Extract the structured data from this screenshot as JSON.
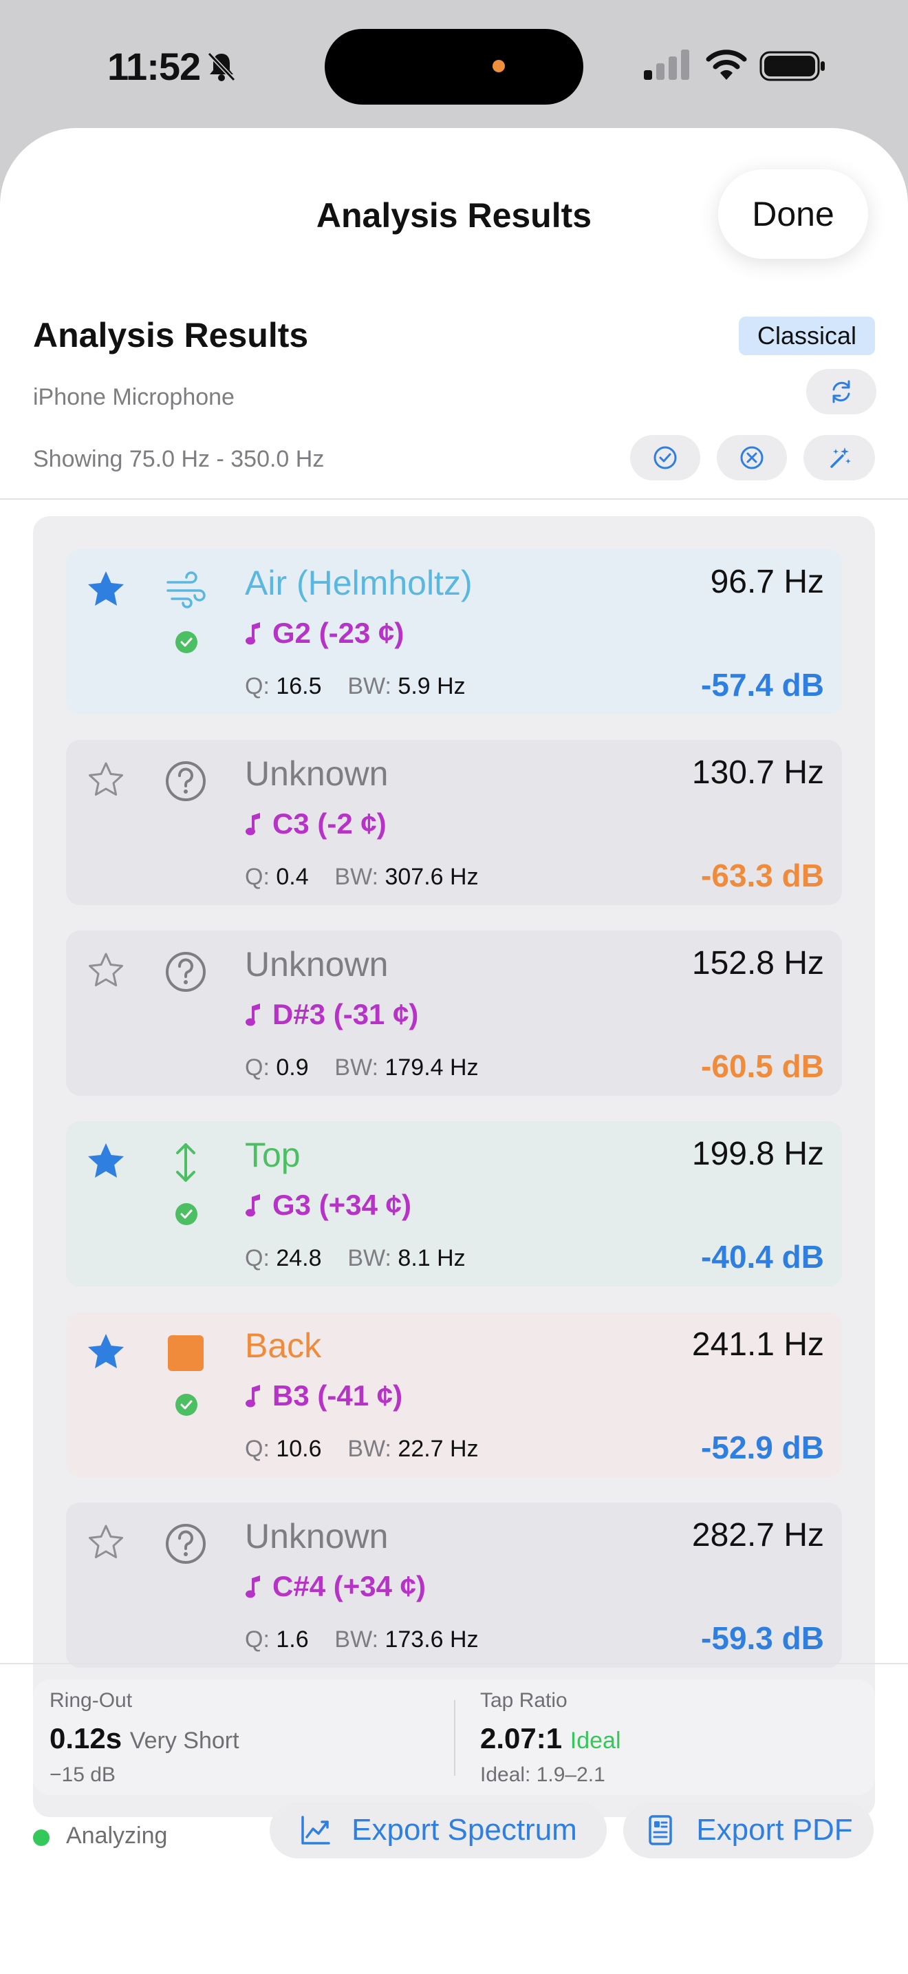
{
  "status_bar": {
    "time": "11:52"
  },
  "nav": {
    "title": "Analysis Results",
    "done_label": "Done"
  },
  "header": {
    "title": "Analysis Results",
    "badge": "Classical",
    "source": "iPhone Microphone",
    "range": "Showing 75.0 Hz - 350.0 Hz"
  },
  "peaks": [
    {
      "starred": true,
      "kind": "wind-icon",
      "confirmed": true,
      "name": "Air (Helmholtz)",
      "name_color": "#5ab8e0",
      "freq": "96.7 Hz",
      "note": "G2 (-23 ¢)",
      "q_label": "Q:",
      "q": "16.5",
      "bw_label": "BW:",
      "bw": "5.9 Hz",
      "db": "-57.4 dB",
      "db_color": "#2f7fe0",
      "bg": "#e4eef4"
    },
    {
      "starred": false,
      "kind": "question-icon",
      "confirmed": false,
      "name": "Unknown",
      "name_color": "#7d7d82",
      "freq": "130.7 Hz",
      "note": "C3 (-2 ¢)",
      "q_label": "Q:",
      "q": "0.4",
      "bw_label": "BW:",
      "bw": "307.6 Hz",
      "db": "-63.3 dB",
      "db_color": "#ef8b3a",
      "bg": "#e6e6ea"
    },
    {
      "starred": false,
      "kind": "question-icon",
      "confirmed": false,
      "name": "Unknown",
      "name_color": "#7d7d82",
      "freq": "152.8 Hz",
      "note": "D#3 (-31 ¢)",
      "q_label": "Q:",
      "q": "0.9",
      "bw_label": "BW:",
      "bw": "179.4 Hz",
      "db": "-60.5 dB",
      "db_color": "#ef8b3a",
      "bg": "#e6e6ea"
    },
    {
      "starred": true,
      "kind": "vertical-arrows-icon",
      "confirmed": true,
      "name": "Top",
      "name_color": "#4cbf63",
      "freq": "199.8 Hz",
      "note": "G3 (+34 ¢)",
      "q_label": "Q:",
      "q": "24.8",
      "bw_label": "BW:",
      "bw": "8.1 Hz",
      "db": "-40.4 dB",
      "db_color": "#2f7fe0",
      "bg": "#e5ecec"
    },
    {
      "starred": true,
      "kind": "square-icon",
      "confirmed": true,
      "name": "Back",
      "name_color": "#ef8b3a",
      "freq": "241.1 Hz",
      "note": "B3 (-41 ¢)",
      "q_label": "Q:",
      "q": "10.6",
      "bw_label": "BW:",
      "bw": "22.7 Hz",
      "db": "-52.9 dB",
      "db_color": "#2f7fe0",
      "bg": "#f1e9ea"
    },
    {
      "starred": false,
      "kind": "question-icon",
      "confirmed": false,
      "name": "Unknown",
      "name_color": "#7d7d82",
      "freq": "282.7 Hz",
      "note": "C#4 (+34 ¢)",
      "q_label": "Q:",
      "q": "1.6",
      "bw_label": "BW:",
      "bw": "173.6 Hz",
      "db": "-59.3 dB",
      "db_color": "#2f7fe0",
      "bg": "#e6e6ea"
    }
  ],
  "stats": {
    "ringout": {
      "label": "Ring-Out",
      "value": "0.12s",
      "qualifier": "Very Short",
      "foot": "−15 dB"
    },
    "tap_ratio": {
      "label": "Tap Ratio",
      "value": "2.07:1",
      "qualifier": "Ideal",
      "qualifier_color": "#34c759",
      "foot": "Ideal: 1.9–2.1"
    }
  },
  "footer": {
    "status": "Analyzing",
    "export_spectrum": "Export Spectrum",
    "export_pdf": "Export PDF"
  },
  "colors": {
    "accent": "#2f7fe0",
    "star": "#2f7fe0",
    "check": "#4cbf63",
    "note": "#b732c7"
  }
}
